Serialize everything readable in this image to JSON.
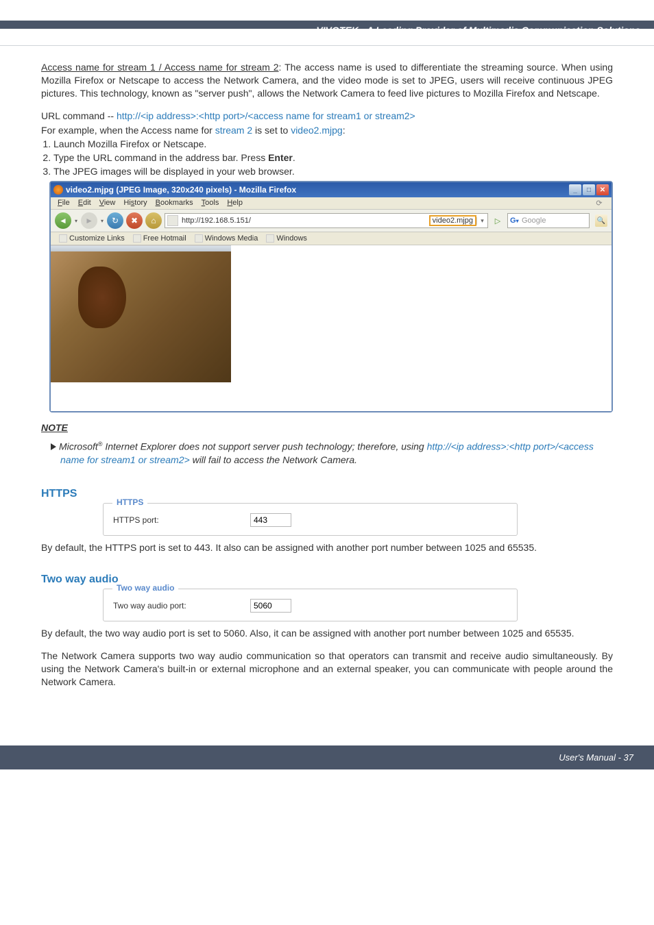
{
  "header": {
    "title": "VIVOTEK - A Leading Provider of Multimedia Communication Solutions"
  },
  "body": {
    "access_heading": "Access name for stream 1 / Access name for stream 2",
    "access_para": ": The access name is used to differentiate the streaming source. When using Mozilla Firefox or Netscape to access the Network Camera, and the video mode is set to JPEG, users will receive continuous JPEG pictures. This technology, known as \"server push\", allows the Network Camera to feed live pictures to Mozilla Firefox and Netscape.",
    "url_label": "URL command -- ",
    "url_value": "http://<ip address>:<http port>/<access name for stream1 or stream2>",
    "example_lead": "For example, when the Access name for ",
    "example_stream": "stream 2",
    "example_mid": " is set to ",
    "example_file": "video2.mjpg",
    "example_colon": ":",
    "step1": "Launch Mozilla Firefox or Netscape.",
    "step2_a": "Type the URL command in the address bar. Press ",
    "step2_b": "Enter",
    "step2_c": ".",
    "step3": "The JPEG images will be displayed in your web browser."
  },
  "firefox": {
    "title": "video2.mjpg (JPEG Image, 320x240 pixels) - Mozilla Firefox",
    "menu": {
      "file": "File",
      "edit": "Edit",
      "view": "View",
      "history": "History",
      "bookmarks": "Bookmarks",
      "tools": "Tools",
      "help": "Help"
    },
    "addr_base": "http://192.168.5.151/",
    "addr_hl": "video2.mjpg",
    "search_engine": "G",
    "search_placeholder": "Google",
    "bookmarks_bar": {
      "b1": "Customize Links",
      "b2": "Free Hotmail",
      "b3": "Windows Media",
      "b4": "Windows"
    }
  },
  "note": {
    "heading": "NOTE",
    "lead": "Microsoft",
    "reg": "®",
    "body1": " Internet Explorer does not support server push technology; therefore, using ",
    "url": "http://<ip address>:<http port>/<access name for stream1 or stream2>",
    "body2": " will fail to access the Network Camera."
  },
  "https": {
    "title": "HTTPS",
    "legend": "HTTPS",
    "label": "HTTPS port:",
    "value": "443",
    "para": "By default, the HTTPS port is set to 443. It also can be assigned with another port number between 1025 and 65535."
  },
  "twoway": {
    "title": "Two way audio",
    "legend": "Two way audio",
    "label": "Two way audio port:",
    "value": "5060",
    "para1": "By default, the two way audio port is set to 5060. Also, it can be assigned with another port number between 1025 and 65535.",
    "para2": "The Network Camera supports two way audio communication so that operators can transmit and receive audio simultaneously. By using the Network Camera's built-in or external microphone and an external speaker, you can communicate with people around the Network Camera."
  },
  "footer": {
    "text": "User's Manual - 37"
  }
}
